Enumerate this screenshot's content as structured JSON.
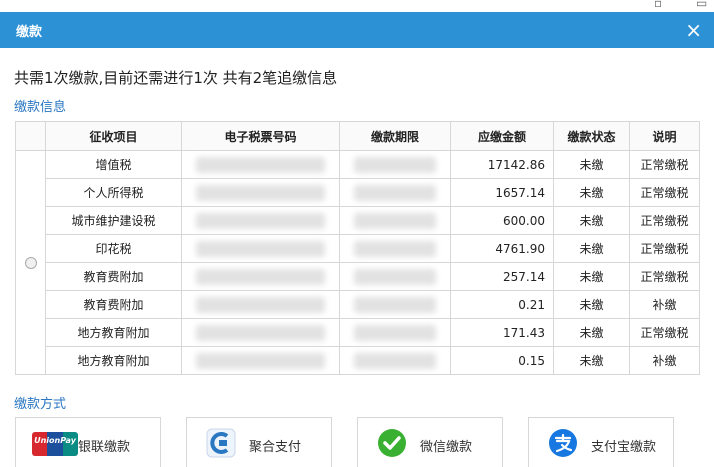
{
  "window": {
    "title": "缴款",
    "close_icon": "close-icon"
  },
  "summary": "共需1次缴款,目前还需进行1次 共有2笔追缴信息",
  "section_info": "缴款信息",
  "section_method": "缴款方式",
  "table": {
    "headers": [
      "征收项目",
      "电子税票号码",
      "缴款期限",
      "应缴金额",
      "缴款状态",
      "说明"
    ],
    "rows": [
      {
        "item": "增值税",
        "amount": "17142.86",
        "status": "未缴",
        "note": "正常缴税"
      },
      {
        "item": "个人所得税",
        "amount": "1657.14",
        "status": "未缴",
        "note": "正常缴税"
      },
      {
        "item": "城市维护建设税",
        "amount": "600.00",
        "status": "未缴",
        "note": "正常缴税"
      },
      {
        "item": "印花税",
        "amount": "4761.90",
        "status": "未缴",
        "note": "正常缴税"
      },
      {
        "item": "教育费附加",
        "amount": "257.14",
        "status": "未缴",
        "note": "正常缴税"
      },
      {
        "item": "教育费附加",
        "amount": "0.21",
        "status": "未缴",
        "note": "补缴"
      },
      {
        "item": "地方教育附加",
        "amount": "171.43",
        "status": "未缴",
        "note": "正常缴税"
      },
      {
        "item": "地方教育附加",
        "amount": "0.15",
        "status": "未缴",
        "note": "补缴"
      }
    ]
  },
  "payment_methods": [
    {
      "label": "银联缴款",
      "icon": "unionpay-icon",
      "logo_text": "UnionPay"
    },
    {
      "label": "聚合支付",
      "icon": "aggregate-pay-icon"
    },
    {
      "label": "微信缴款",
      "icon": "wechat-icon"
    },
    {
      "label": "支付宝缴款",
      "icon": "alipay-icon"
    }
  ],
  "colors": {
    "titlebar": "#2d91d6",
    "link": "#2a77c2",
    "wechat": "#3ab033",
    "alipay": "#1678e0"
  }
}
